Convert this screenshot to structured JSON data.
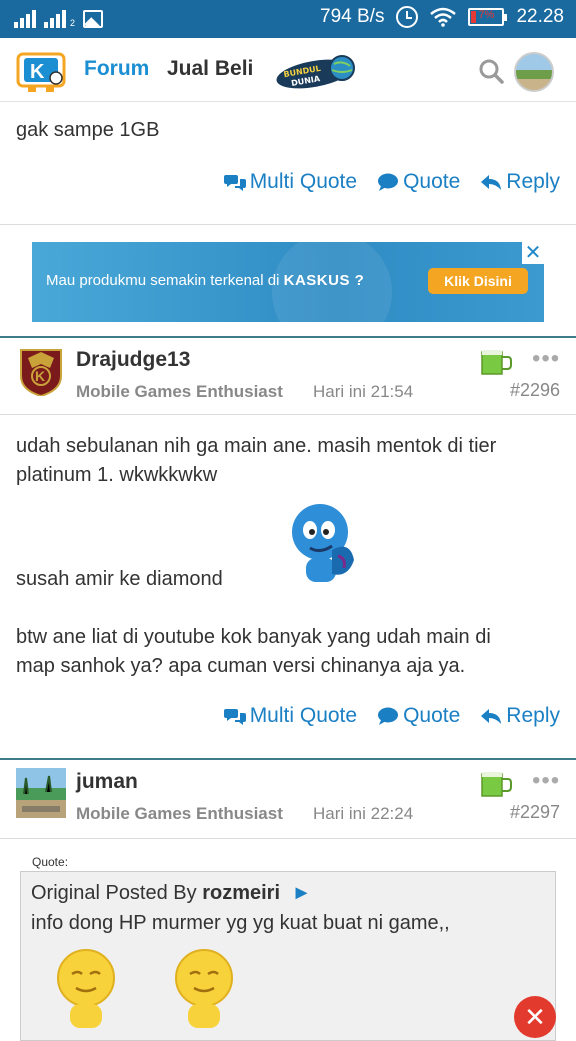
{
  "status_bar": {
    "net_speed": "794 B/s",
    "battery_text": "7%",
    "time": "22.28",
    "sim_indicator": "2"
  },
  "nav": {
    "forum": "Forum",
    "jual_beli": "Jual Beli",
    "bundul_logo_text": "BUNDUL DUNIA"
  },
  "top_post": {
    "text": "gak sampe 1GB"
  },
  "actions": {
    "multi_quote": "Multi Quote",
    "quote": "Quote",
    "reply": "Reply"
  },
  "ad": {
    "text": "Mau produkmu semakin terkenal di",
    "brand": "KASKUS ?",
    "button": "Klik Disini",
    "close": "✕"
  },
  "post1": {
    "username": "Drajudge13",
    "rank": "Mobile Games Enthusiast",
    "time": "Hari ini 21:54",
    "number": "#2296",
    "line1": "udah sebulanan nih ga main ane. masih mentok di tier",
    "line2": "platinum 1. wkwkkwkw",
    "line3": "susah amir ke diamond",
    "line4": "btw ane liat di youtube kok banyak yang udah main di",
    "line5": "map sanhok ya? apa cuman versi chinanya aja ya."
  },
  "post2": {
    "username": "juman",
    "rank": "Mobile Games Enthusiast",
    "time": "Hari ini 22:24",
    "number": "#2297",
    "quote_label": "Quote:",
    "quote_prefix": "Original Posted By",
    "quote_author": "rozmeiri",
    "quote_arrow": "►",
    "quote_text": "info dong HP murmer yg yg kuat buat ni game,,"
  },
  "more_label": "•••",
  "colors": {
    "status_bar": "#1a6aa0",
    "link_blue": "#1b7fc4",
    "forum_blue": "#1b8fd2",
    "ad_button": "#f4a623"
  }
}
